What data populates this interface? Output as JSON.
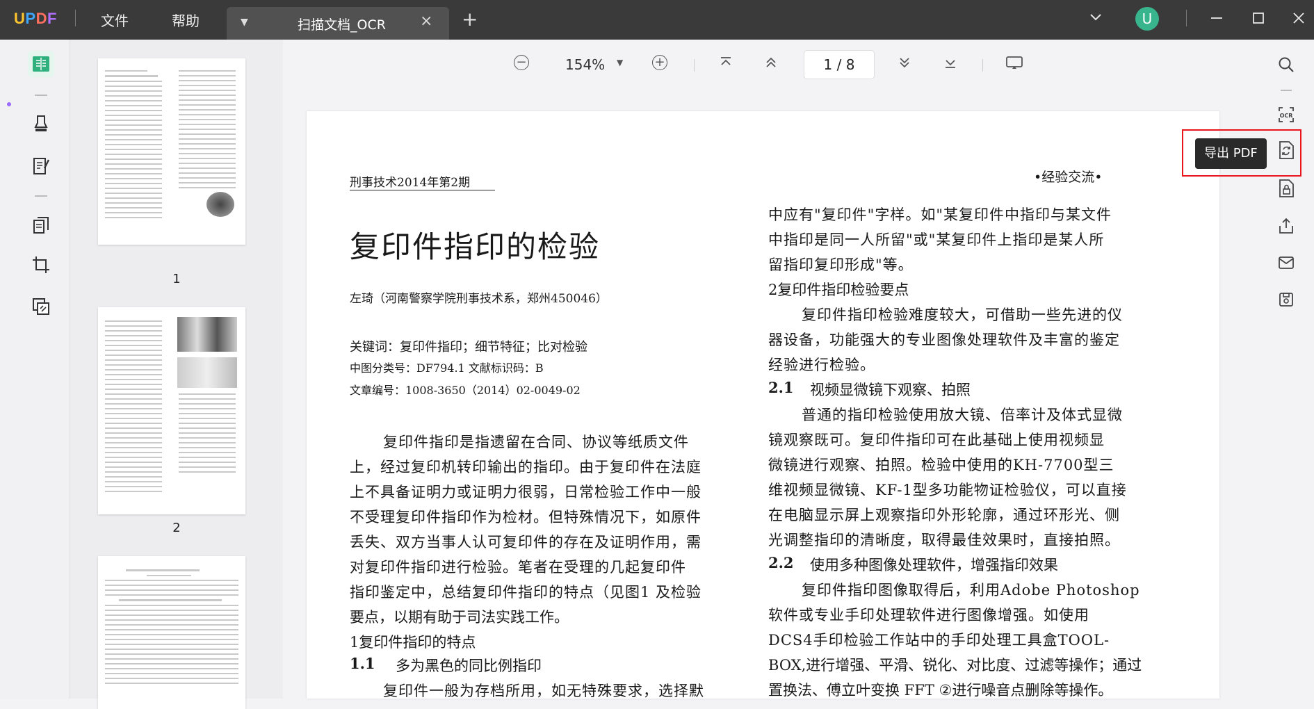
{
  "app": {
    "logo": {
      "u": "U",
      "p": "P",
      "d": "D",
      "f": "F"
    }
  },
  "menu": {
    "file": "文件",
    "help": "帮助"
  },
  "tab": {
    "title": "扫描文档_OCR"
  },
  "user": {
    "avatar_letter": "U"
  },
  "toolbar": {
    "zoom": "154%",
    "page_indicator": "1 / 8"
  },
  "thumbnails": [
    {
      "label": "1"
    },
    {
      "label": "2"
    }
  ],
  "tooltip": {
    "text": "导出 PDF"
  },
  "document": {
    "header_left": "刑事技术2014年第2期",
    "header_right": "•经验交流•",
    "title": "复印件指印的检验",
    "author": "左琦（河南警察学院刑事技术系，郑州450046）",
    "keywords": "关键词：复印件指印；细节特征；比对检验",
    "classification": "中图分类号：DF794.1  文献标识码：B",
    "article_no": "文章编号：1008-3650（2014）02-0049-02",
    "left_body": [
      "复印件指印是指遗留在合同、协议等纸质文件",
      "上，经过复印机转印输出的指印。由于复印件在法庭",
      "上不具备证明力或证明力很弱，日常检验工作中一般",
      "不受理复印件指印作为检材。但特殊情况下，如原件",
      "丢失、双方当事人认可复印件的存在及证明作用，需",
      "对复印件指印进行检验。笔者在受理的几起复印件",
      "指印鉴定中，总结复印件指印的特点（见图1  及检验",
      "要点，以期有助于司法实践工作。"
    ],
    "section1": "1复印件指印的特点",
    "section1_1_num": "1.1",
    "section1_1": "多为黑色的同比例指印",
    "left_last": "复印件一般为存档所用，如无特殊要求，选择默",
    "right_body_top": [
      "中应有\"复印件\"字样。如\"某复印件中指印与某文件",
      "中指印是同一人所留\"或\"某复印件上指印是某人所",
      "留指印复印形成\"等。"
    ],
    "section2": "2复印件指印检验要点",
    "right_body_2": [
      "复印件指印检验难度较大，可借助一些先进的仪",
      "器设备，功能强大的专业图像处理软件及丰富的鉴定",
      "经验进行检验。"
    ],
    "section2_1_num": "2.1",
    "section2_1": "视频显微镜下观察、拍照",
    "right_body_3": [
      "普通的指印检验使用放大镜、倍率计及体式显微",
      "镜观察既可。复印件指印可在此基础上使用视频显",
      "微镜进行观察、拍照。检验中使用的KH-7700型三",
      "维视频显微镜、KF-1型多功能物证检验仪，可以直接",
      "在电脑显示屏上观察指印外形轮廓，通过环形光、侧",
      "光调整指印的清晰度，取得最佳效果时，直接拍照。"
    ],
    "section2_2_num": "2.2",
    "section2_2": "使用多种图像处理软件，增强指印效果",
    "right_body_4": [
      "复印件指印图像取得后，利用Adobe Photoshop",
      "软件或专业手印处理软件进行图像增强。如使用",
      "DCS4手印检验工作站中的手印处理工具盒TOOL-",
      "BOX,进行增强、平滑、锐化、对比度、过滤等操作；通过",
      "置换法、傅立叶变换  FFT  ②进行噪音点删除等操作。"
    ]
  },
  "colors": {
    "accent": "#38b58c",
    "highlight": "#e8161c",
    "titlebar": "#3a3a3a"
  }
}
